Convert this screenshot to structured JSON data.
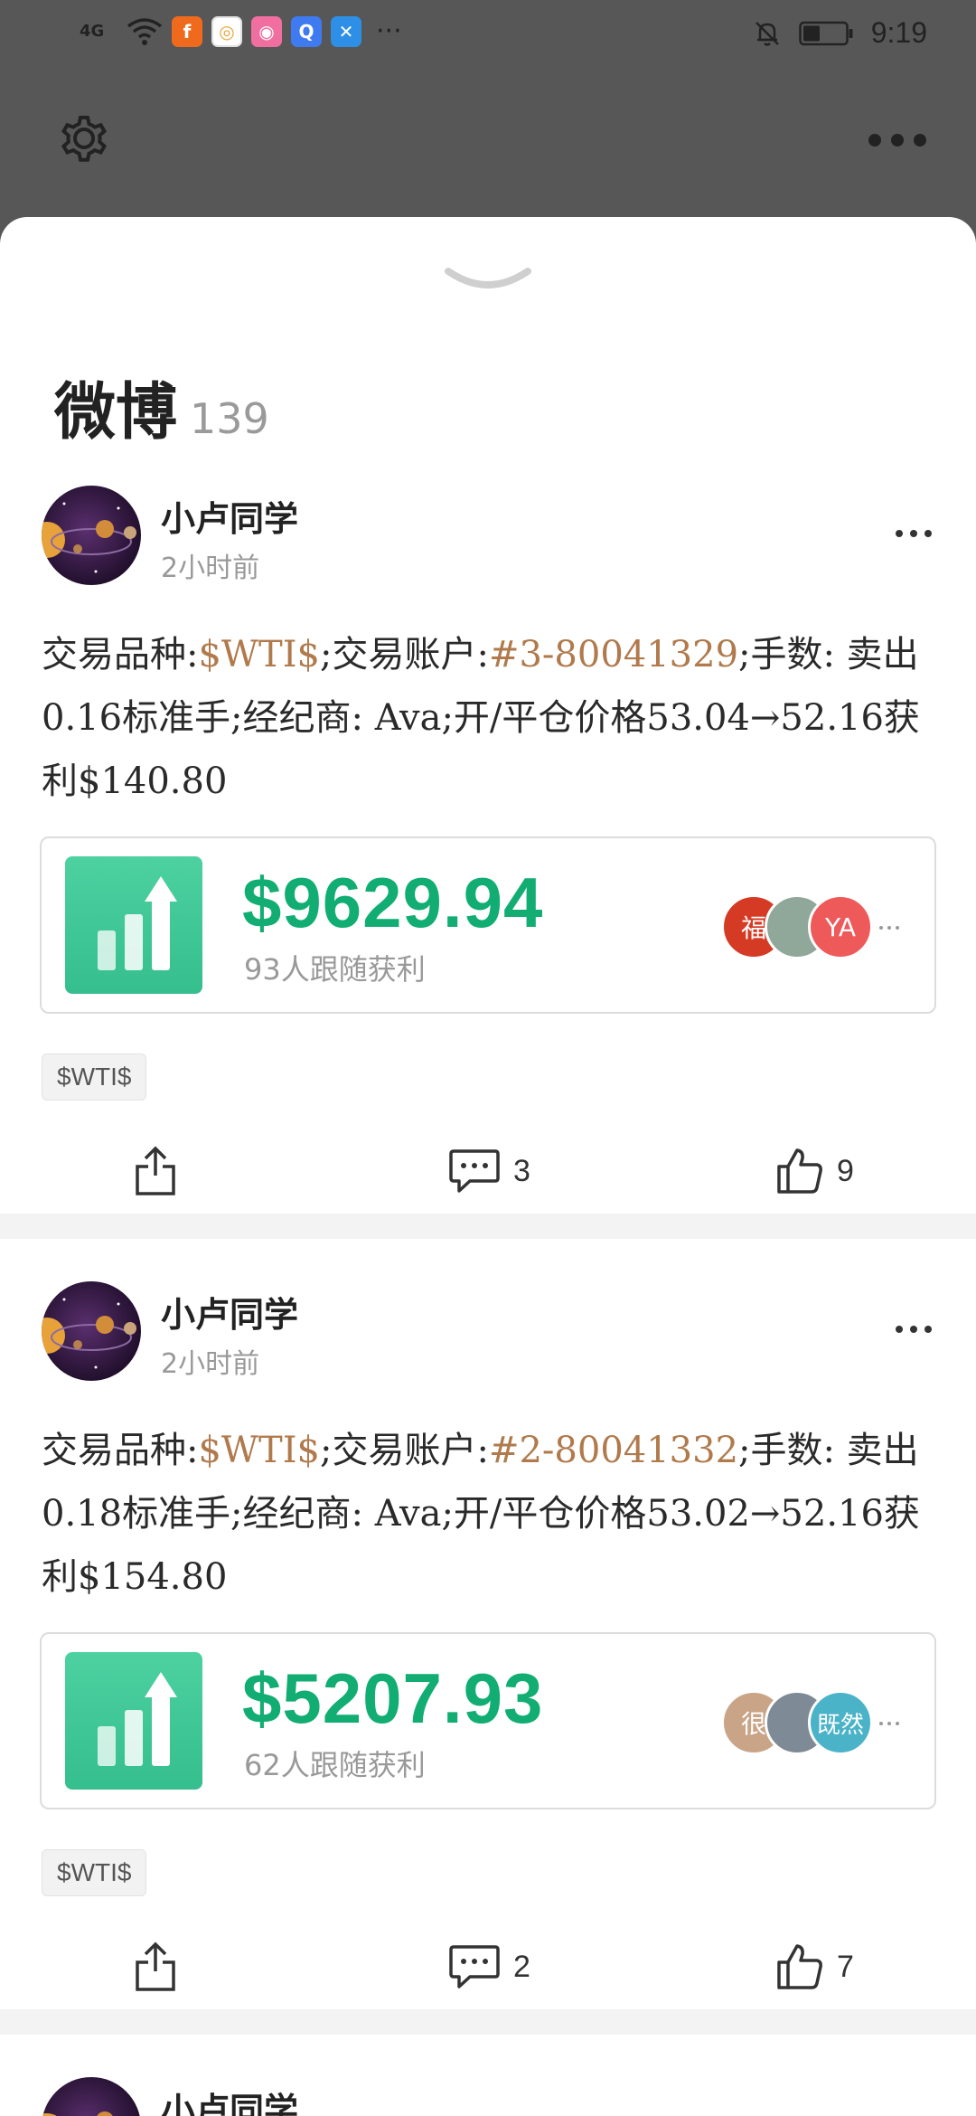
{
  "status_bar": {
    "network": "4G",
    "time": "9:19",
    "more": "···",
    "apps": [
      {
        "icon": "flash-app-icon",
        "glyph": "f",
        "color": "#f06a1e"
      },
      {
        "icon": "browser-app-icon",
        "glyph": "◎",
        "color": "#e9a53a"
      },
      {
        "icon": "camera-app-icon",
        "glyph": "◉",
        "color": "#f06fa0"
      },
      {
        "icon": "search-app-icon",
        "glyph": "Q",
        "color": "#3f7bf0"
      },
      {
        "icon": "xs-app-icon",
        "glyph": "✕",
        "color": "#2e8fe6"
      }
    ]
  },
  "header": {
    "settings_icon": "gear-icon",
    "more_icon": "more-horizontal-icon"
  },
  "section": {
    "title": "微博",
    "count": "139"
  },
  "posts": [
    {
      "author": "小卢同学",
      "time": "2小时前",
      "content": {
        "p1": "交易品种:",
        "sym": "$WTI$",
        "p2": ";交易账户:",
        "acct": "#3-80041329",
        "p3": ";手数: 卖出0.16标准手;经纪商: Ava;开/平仓价格53.04→52.16获利$140.80"
      },
      "amount": "$9629.94",
      "followers": "93人跟随获利",
      "faces": [
        {
          "label": "福",
          "color": "#d53a24"
        },
        {
          "label": "",
          "color": "#8fa89a"
        },
        {
          "label": "YA",
          "color": "#ee5a5a"
        }
      ],
      "face_more": "...",
      "tag": "$WTI$",
      "comments": "3",
      "likes": "9"
    },
    {
      "author": "小卢同学",
      "time": "2小时前",
      "content": {
        "p1": "交易品种:",
        "sym": "$WTI$",
        "p2": ";交易账户:",
        "acct": "#2-80041332",
        "p3": ";手数: 卖出0.18标准手;经纪商: Ava;开/平仓价格53.02→52.16获利$154.80"
      },
      "amount": "$5207.93",
      "followers": "62人跟随获利",
      "faces": [
        {
          "label": "很",
          "color": "#c9a487"
        },
        {
          "label": "",
          "color": "#7e8a96"
        },
        {
          "label": "既然",
          "color": "#4bb3c8"
        }
      ],
      "face_more": "...",
      "tag": "$WTI$",
      "comments": "2",
      "likes": "7"
    },
    {
      "author": "小卢同学"
    }
  ]
}
